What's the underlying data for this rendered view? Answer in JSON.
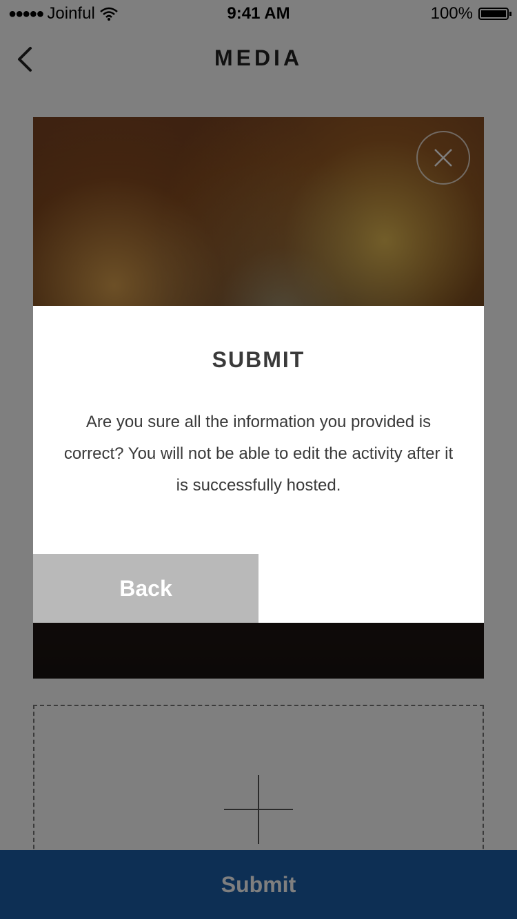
{
  "status_bar": {
    "signal": "●●●●●",
    "carrier": "Joinful",
    "time": "9:41 AM",
    "battery": "100%"
  },
  "nav": {
    "title": "MEDIA"
  },
  "media": {
    "photo_icon": "close-icon",
    "add_icon": "plus-icon"
  },
  "footer": {
    "submit_label": "Submit",
    "bar_color": "#1b5fa8"
  },
  "dialog": {
    "title": "SUBMIT",
    "message": "Are you sure all the information you provided is correct?  You will not be able to edit the activity after it is successfully hosted.",
    "back_label": "Back"
  }
}
